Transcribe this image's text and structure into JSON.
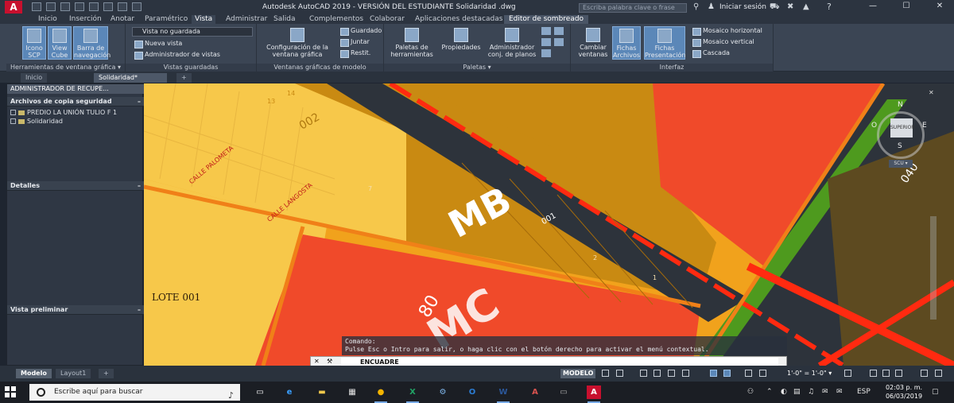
{
  "window": {
    "app_logo": "A",
    "title": "Autodesk AutoCAD 2019 - VERSIÓN DEL ESTUDIANTE     Solidaridad .dwg",
    "search_placeholder": "Escriba palabra clave o frase",
    "login": "Iniciar sesión",
    "minimize": "—",
    "restore": "☐",
    "close": "✕"
  },
  "ribbon_tabs": [
    "Inicio",
    "Inserción",
    "Anotar",
    "Paramétrico",
    "Vista",
    "Administrar",
    "Salida",
    "Complementos",
    "Colaborar",
    "Aplicaciones destacadas",
    "Editor de sombreado"
  ],
  "ribbon": {
    "panels": {
      "viewport_tools": {
        "title": "Herramientas de ventana gráfica ▾",
        "buttons": [
          "Icono SCP",
          "View Cube",
          "Barra de navegación"
        ]
      },
      "saved_views": {
        "title": "Vistas guardadas",
        "dropdown": "Vista no guardada",
        "items": [
          "Nueva vista",
          "Administrador de vistas"
        ]
      },
      "model_viewports": {
        "title": "Ventanas gráficas de modelo",
        "config_button": "Configuración de la ventana gráfica",
        "items": [
          "Guardado",
          "Juntar",
          "Restit."
        ]
      },
      "palettes": {
        "title": "Paletas ▾",
        "buttons": [
          "Paletas de herramientas",
          "Propiedades",
          "Administrador conj. de planos"
        ]
      },
      "interface": {
        "title": "Interfaz",
        "buttons": [
          "Cambiar ventanas",
          "Fichas Archivos",
          "Fichas Presentación"
        ],
        "items": [
          "Mosaico horizontal",
          "Mosaico vertical",
          "Cascada"
        ]
      }
    }
  },
  "doc_tabs": [
    "Inicio",
    "Solidaridad*"
  ],
  "palette": {
    "title": "ADMINISTRADOR DE RECUPE...",
    "sections": {
      "backup": {
        "title": "Archivos de copia seguridad",
        "items": [
          "PREDIO LA UNIÓN TULIO F 1",
          "Solidaridad"
        ]
      },
      "details": {
        "title": "Detalles"
      },
      "preview": {
        "title": "Vista preliminar"
      }
    }
  },
  "drawing": {
    "labels": {
      "mb": "MB",
      "mc": "MC",
      "lote": "LOTE 001",
      "calle_paloma": "CALLE PALOMETA",
      "calle_langosta": "CALLE LANGOSTA",
      "lot_001": "001",
      "lot_002": "002",
      "code_040": "040",
      "num_80": "80",
      "num_1": "1",
      "num_2": "2",
      "num_7": "7",
      "num_14": "14",
      "num_13": "13"
    },
    "colors": {
      "yellow": "#f7c84a",
      "dark_yellow": "#c9860f",
      "orange": "#f08018",
      "red": "#f04a2a",
      "road": "#2d333b",
      "green": "#4e9a1e",
      "bright_red": "#ff2a10"
    }
  },
  "viewcube": {
    "n": "N",
    "s": "S",
    "e": "E",
    "o": "O",
    "top": "SUPERIOR",
    "wcs": "SCU ▾"
  },
  "command": {
    "history_1": "Comando:",
    "history_2": "Pulse Esc o Intro para salir, o haga clic con el botón derecho para activar el menú contextual.",
    "input": "ENCUADRE",
    "close": "✕",
    "wrench": "🔧"
  },
  "layout_tabs": [
    "Modelo",
    "Layout1",
    "+"
  ],
  "status": {
    "mode": "MODELO",
    "scale": "1'-0\" = 1'-0\" ▾"
  },
  "taskbar": {
    "search": "Escribe aquí para buscar",
    "lang": "ESP",
    "time": "02:03 p. m.",
    "date": "06/03/2019"
  }
}
